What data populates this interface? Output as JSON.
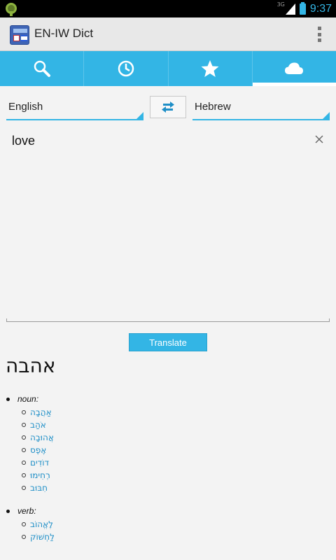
{
  "status_bar": {
    "network": "3G",
    "time": "9:37",
    "icons": [
      "android-icon",
      "signal-icon",
      "battery-icon"
    ]
  },
  "action_bar": {
    "title": "EN-IW Dict",
    "icons": [
      "app-icon",
      "overflow-menu-icon"
    ]
  },
  "tabs": [
    {
      "icon": "search-icon",
      "selected": false
    },
    {
      "icon": "history-icon",
      "selected": false
    },
    {
      "icon": "star-icon",
      "selected": false
    },
    {
      "icon": "cloud-icon",
      "selected": true
    }
  ],
  "languages": {
    "source": "English",
    "target": "Hebrew",
    "swap_icon": "swap-icon"
  },
  "input": {
    "value": "love",
    "clear_icon": "close-icon"
  },
  "translate_button": "Translate",
  "result": {
    "word": "אהבה",
    "noun_label": "noun:",
    "nouns": [
      "אַהֲבָה",
      "אֹהַב",
      "אֲהוּבָה",
      "אֶפֶס",
      "דוֹדִים",
      "רְחִימוּ",
      "חִבּוּב"
    ],
    "verb_label": "verb:",
    "verbs": [
      "לֶאֱהוֹב",
      "לַחְשׁוֹק"
    ]
  },
  "colors": {
    "accent": "#33b5e5",
    "link": "#1f8fc7",
    "background": "#f3f3f3"
  }
}
